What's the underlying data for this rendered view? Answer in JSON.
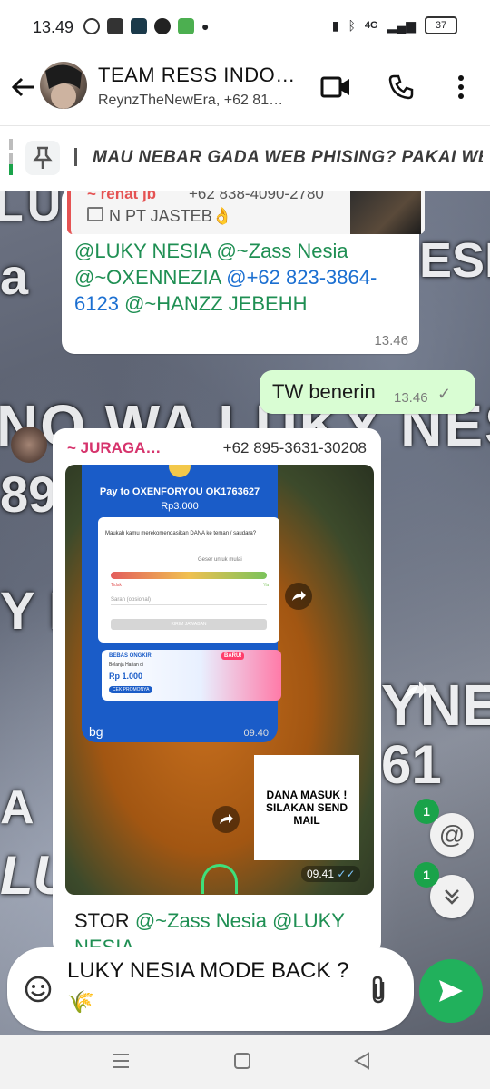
{
  "status_bar": {
    "time": "13.49",
    "network": "4G",
    "battery": "37"
  },
  "header": {
    "title": "TEAM RESS INDO…",
    "subtitle": "ReynzTheNewEra, +62 81…"
  },
  "pinned": {
    "text": "MAU NEBAR GADA WEB PHISING? PAKAI WE"
  },
  "background_words": [
    "LUKY",
    "a",
    "ESIA",
    "NO WA LUKY NESIA",
    "89",
    "Y N",
    "YNES",
    "61",
    "A",
    "LU"
  ],
  "messages": [
    {
      "quote": {
        "author": "~ renat jb",
        "phone": "+62 838-4090-2780",
        "text": "N PT JASTEB👌"
      },
      "text_parts": [
        "@LUKY NESIA",
        "@~Zass Nesia",
        "@~OXENNEZIA",
        "@+62 823-3864-6123",
        "@~HANZZ JEBEHH"
      ],
      "time": "13.46"
    },
    {
      "text": "TW benerin",
      "time": "13.46"
    },
    {
      "sender": "~ JURAGA…",
      "sender_phone": "+62 895-3631-30208",
      "screenshot": {
        "pay_to": "Pay to OXENFORYOU OK1763627",
        "amount": "Rp3.000",
        "question": "Maukah kamu merekomendasikan DANA ke teman / saudara?",
        "slider_hint": "Geser untuk mulai",
        "label_low": "Tidak",
        "label_high": "Ya",
        "input_placeholder": "Saran (opsional)",
        "submit": "KIRIM JAWABAN",
        "promo_title": "BEBAS ONGKIR",
        "promo_sub": "Belanja Harian di",
        "promo_price": "Rp 1.000",
        "promo_cta": "CEK PROMONYA",
        "promo_badge": "BARU!",
        "caption": "bg",
        "caption_time": "09.40"
      },
      "stamp_text": "DANA MASUK ! SILAKAN SEND MAIL",
      "stamp_time": "09.41",
      "text_parts": [
        "STOR ",
        "@~Zass Nesia",
        "@LUKY NESIA"
      ]
    }
  ],
  "fabs": {
    "mention_badge": "1",
    "scroll_badge": "1"
  },
  "composer": {
    "text": "LUKY NESIA MODE BACK ? 🌾"
  }
}
